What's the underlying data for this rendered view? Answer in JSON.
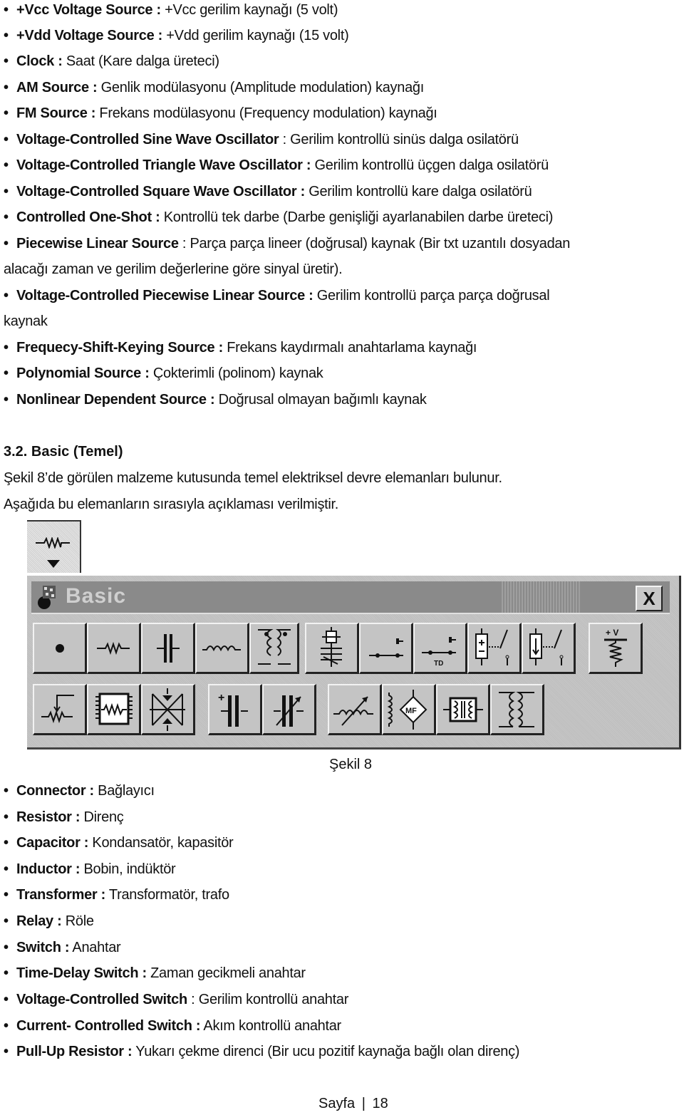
{
  "top_list": [
    {
      "term": "+Vcc Voltage Source :",
      "desc": " +Vcc gerilim kaynağı (5 volt)"
    },
    {
      "term": "+Vdd Voltage Source :",
      "desc": " +Vdd gerilim kaynağı (15 volt)"
    },
    {
      "term": "Clock :",
      "desc": " Saat (Kare dalga üreteci)"
    },
    {
      "term": "AM Source :",
      "desc": " Genlik modülasyonu (Amplitude modulation) kaynağı"
    },
    {
      "term": "FM Source :",
      "desc": " Frekans modülasyonu (Frequency modulation) kaynağı"
    },
    {
      "term": "Voltage-Controlled Sine Wave Oscillator",
      "desc": " : Gerilim kontrollü sinüs dalga osilatörü"
    },
    {
      "term": "Voltage-Controlled Triangle Wave Oscillator :",
      "desc": " Gerilim kontrollü üçgen dalga osilatörü"
    },
    {
      "term": "Voltage-Controlled Square Wave Oscillator :",
      "desc": " Gerilim kontrollü kare dalga osilatörü"
    },
    {
      "term": "Controlled One-Shot :",
      "desc": " Kontrollü tek darbe (Darbe genişliği ayarlanabilen darbe üreteci)"
    },
    {
      "term": "Piecewise Linear Source",
      "desc": " : Parça parça lineer (doğrusal) kaynak (Bir txt uzantılı dosyadan",
      "cont": "alacağı zaman ve gerilim değerlerine göre sinyal üretir)."
    },
    {
      "term": "Voltage-Controlled Piecewise Linear Source :",
      "desc": " Gerilim kontrollü parça parça doğrusal",
      "cont": "kaynak"
    },
    {
      "term": "Frequecy-Shift-Keying Source :",
      "desc": " Frekans kaydırmalı anahtarlama kaynağı"
    },
    {
      "term": "Polynomial Source :",
      "desc": " Çokterimli (polinom) kaynak"
    },
    {
      "term": "Nonlinear Dependent Source :",
      "desc": " Doğrusal olmayan bağımlı kaynak"
    }
  ],
  "section": {
    "heading": "3.2. Basic (Temel)",
    "para1": "Şekil 8’de görülen malzeme kutusunda temel elektriksel devre elemanları bulunur.",
    "para2": "Aşağıda bu elemanların sırasıyla açıklaması verilmiştir."
  },
  "palette": {
    "title": "Basic",
    "close_label": "X",
    "row1": [
      "connector",
      "resistor",
      "capacitor",
      "inductor",
      "transformer",
      "relay",
      "switch",
      "time-delay-switch",
      "voltage-controlled-switch",
      "current-controlled-switch",
      "pull-up-resistor"
    ],
    "row2": [
      "potentiometer",
      "resistor-pack",
      "bridge",
      "electrolytic-capacitor",
      "variable-capacitor",
      "variable-inductor",
      "magnetic-core-coil",
      "nonlinear-transformer",
      "ideal-transformer"
    ]
  },
  "figure_caption": "Şekil 8",
  "bottom_list": [
    {
      "term": "Connector :",
      "desc": " Bağlayıcı"
    },
    {
      "term": "Resistor :",
      "desc": " Direnç"
    },
    {
      "term": "Capacitor :",
      "desc": " Kondansatör, kapasitör"
    },
    {
      "term": "Inductor :",
      "desc": " Bobin, indüktör"
    },
    {
      "term": "Transformer :",
      "desc": " Transformatör, trafo"
    },
    {
      "term": "Relay :",
      "desc": " Röle"
    },
    {
      "term": "Switch :",
      "desc": " Anahtar"
    },
    {
      "term": "Time-Delay Switch :",
      "desc": " Zaman gecikmeli anahtar"
    },
    {
      "term": "Voltage-Controlled Switch",
      "desc": " : Gerilim kontrollü anahtar"
    },
    {
      "term": "Current- Controlled Switch :",
      "desc": " Akım kontrollü anahtar"
    },
    {
      "term": "Pull-Up Resistor :",
      "desc": " Yukarı çekme direnci (Bir ucu pozitif kaynağa bağlı olan direnç)"
    }
  ],
  "footer": {
    "label": "Sayfa",
    "page": "18"
  },
  "bullet": "•"
}
